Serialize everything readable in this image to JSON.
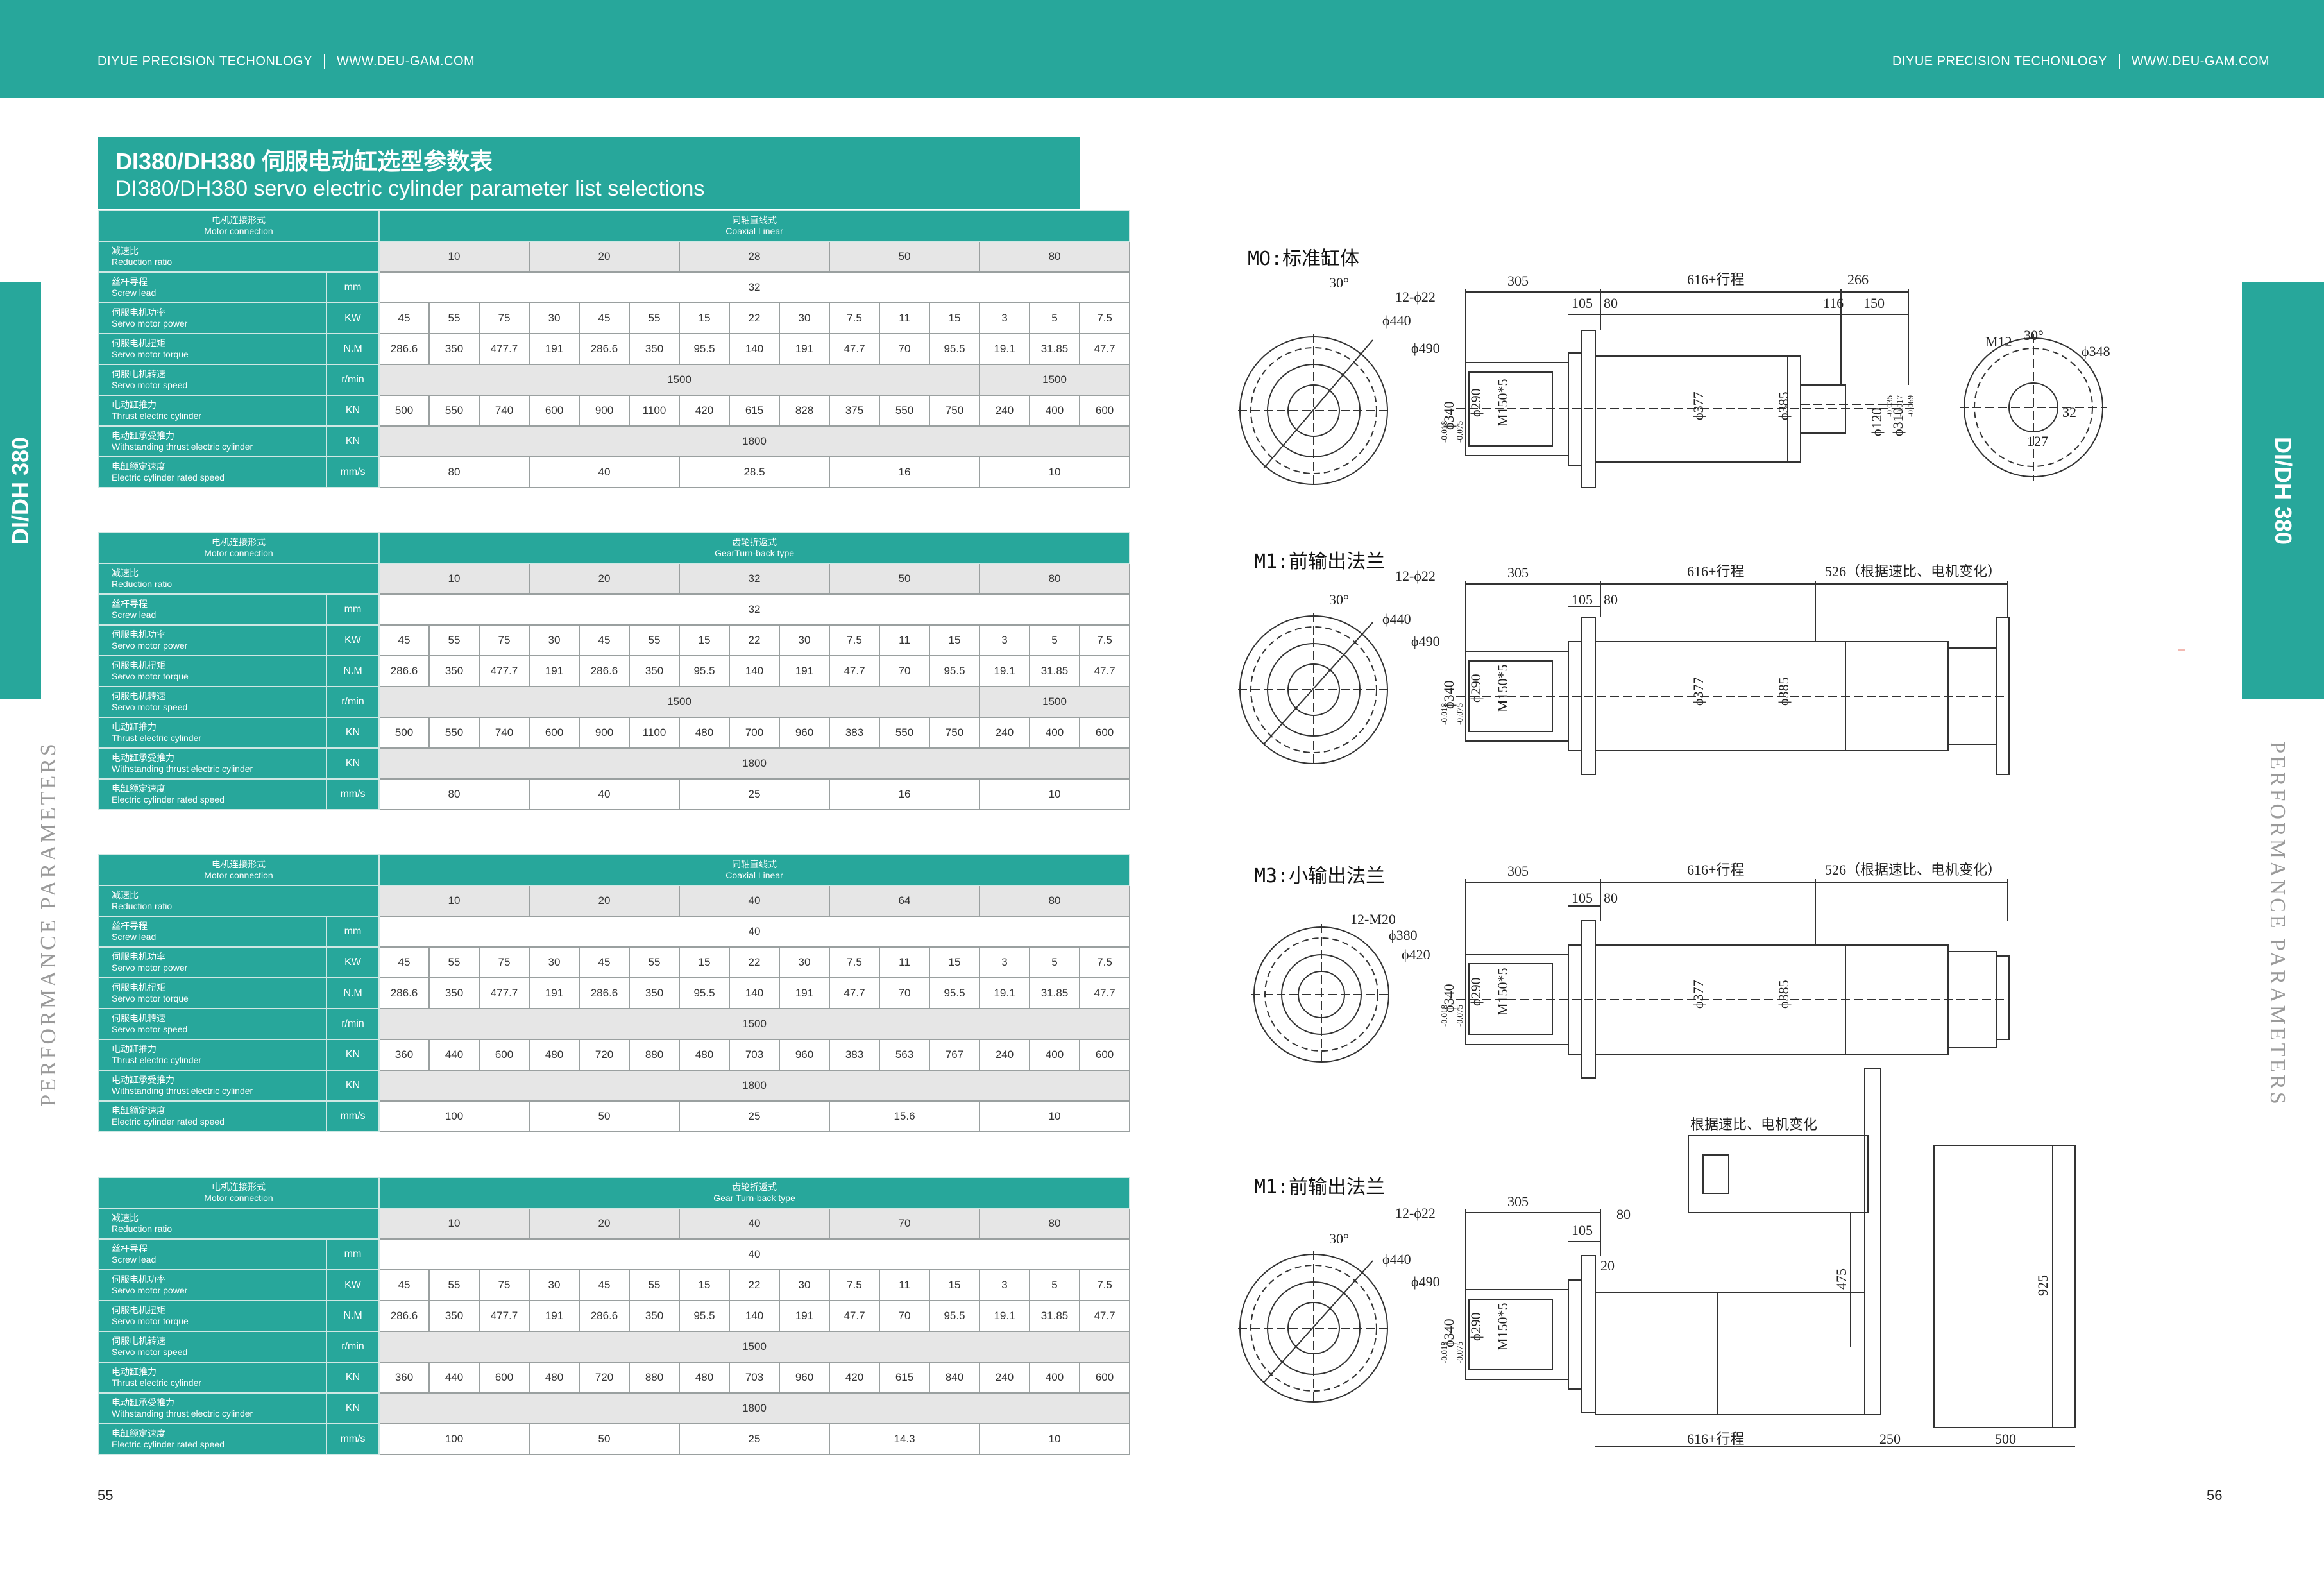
{
  "header": {
    "left": {
      "company": "DIYUE PRECISION TECHONLOGY",
      "url": "WWW.DEU-GAM.COM"
    },
    "right": {
      "company": "DIYUE PRECISION TECHONLOGY",
      "url": "WWW.DEU-GAM.COM"
    }
  },
  "side": {
    "left_tab": "DI/DH 380",
    "right_tab": "DI/DH 380",
    "left_vertical": "PERFORMANCE PARAMETERS",
    "right_vertical": "PERFORMANCE PARAMETERS"
  },
  "title": {
    "cn": "DI380/DH380 伺服电动缸选型参数表",
    "en": "DI380/DH380 servo electric cylinder parameter list selections"
  },
  "row_labels": {
    "conn": {
      "cn": "电机连接形式",
      "en": "Motor connection"
    },
    "ratio": {
      "cn": "减速比",
      "en": "Reduction ratio"
    },
    "lead": {
      "cn": "丝杆导程",
      "en": "Screw lead"
    },
    "power": {
      "cn": "伺服电机功率",
      "en": "Servo motor power"
    },
    "torque": {
      "cn": "伺服电机扭矩",
      "en": "Servo motor torque"
    },
    "speed": {
      "cn": "伺服电机转速",
      "en": "Servo motor speed"
    },
    "thrust": {
      "cn": "电动缸推力",
      "en": "Thrust electric cylinder"
    },
    "withstand": {
      "cn": "电动缸承受推力",
      "en": "Withstanding thrust electric cylinder"
    },
    "rated": {
      "cn": "电缸额定速度",
      "en": "Electric cylinder rated speed"
    }
  },
  "units": {
    "lead": "mm",
    "power": "KW",
    "torque": "N.M",
    "speed": "r/min",
    "thrust": "KN",
    "withstand": "KN",
    "rated": "mm/s"
  },
  "tables": [
    {
      "conn_cn": "同轴直线式",
      "conn_en": "Coaxial Linear",
      "ratios": [
        "10",
        "20",
        "28",
        "50",
        "80"
      ],
      "lead": "32",
      "power": [
        "45",
        "55",
        "75",
        "30",
        "45",
        "55",
        "15",
        "22",
        "30",
        "7.5",
        "11",
        "15",
        "3",
        "5",
        "7.5"
      ],
      "torque": [
        "286.6",
        "350",
        "477.7",
        "191",
        "286.6",
        "350",
        "95.5",
        "140",
        "191",
        "47.7",
        "70",
        "95.5",
        "19.1",
        "31.85",
        "47.7"
      ],
      "speed": [
        "1500",
        "1500"
      ],
      "thrust": [
        "500",
        "550",
        "740",
        "600",
        "900",
        "1100",
        "420",
        "615",
        "828",
        "375",
        "550",
        "750",
        "240",
        "400",
        "600"
      ],
      "withstand": "1800",
      "rated": [
        "80",
        "40",
        "28.5",
        "16",
        "10"
      ]
    },
    {
      "conn_cn": "齿轮折返式",
      "conn_en": "GearTurn-back type",
      "ratios": [
        "10",
        "20",
        "32",
        "50",
        "80"
      ],
      "lead": "32",
      "power": [
        "45",
        "55",
        "75",
        "30",
        "45",
        "55",
        "15",
        "22",
        "30",
        "7.5",
        "11",
        "15",
        "3",
        "5",
        "7.5"
      ],
      "torque": [
        "286.6",
        "350",
        "477.7",
        "191",
        "286.6",
        "350",
        "95.5",
        "140",
        "191",
        "47.7",
        "70",
        "95.5",
        "19.1",
        "31.85",
        "47.7"
      ],
      "speed": [
        "1500",
        "1500"
      ],
      "thrust": [
        "500",
        "550",
        "740",
        "600",
        "900",
        "1100",
        "480",
        "700",
        "960",
        "383",
        "550",
        "750",
        "240",
        "400",
        "600"
      ],
      "withstand": "1800",
      "rated": [
        "80",
        "40",
        "25",
        "16",
        "10"
      ]
    },
    {
      "conn_cn": "同轴直线式",
      "conn_en": "Coaxial Linear",
      "ratios": [
        "10",
        "20",
        "40",
        "64",
        "80"
      ],
      "lead": "40",
      "power": [
        "45",
        "55",
        "75",
        "30",
        "45",
        "55",
        "15",
        "22",
        "30",
        "7.5",
        "11",
        "15",
        "3",
        "5",
        "7.5"
      ],
      "torque": [
        "286.6",
        "350",
        "477.7",
        "191",
        "286.6",
        "350",
        "95.5",
        "140",
        "191",
        "47.7",
        "70",
        "95.5",
        "19.1",
        "31.85",
        "47.7"
      ],
      "speed": [
        "1500"
      ],
      "thrust": [
        "360",
        "440",
        "600",
        "480",
        "720",
        "880",
        "480",
        "703",
        "960",
        "383",
        "563",
        "767",
        "240",
        "400",
        "600"
      ],
      "withstand": "1800",
      "rated": [
        "100",
        "50",
        "25",
        "15.6",
        "10"
      ]
    },
    {
      "conn_cn": "齿轮折返式",
      "conn_en": "Gear Turn-back type",
      "ratios": [
        "10",
        "20",
        "40",
        "70",
        "80"
      ],
      "lead": "40",
      "power": [
        "45",
        "55",
        "75",
        "30",
        "45",
        "55",
        "15",
        "22",
        "30",
        "7.5",
        "11",
        "15",
        "3",
        "5",
        "7.5"
      ],
      "torque": [
        "286.6",
        "350",
        "477.7",
        "191",
        "286.6",
        "350",
        "95.5",
        "140",
        "191",
        "47.7",
        "70",
        "95.5",
        "19.1",
        "31.85",
        "47.7"
      ],
      "speed": [
        "1500"
      ],
      "thrust": [
        "360",
        "440",
        "600",
        "480",
        "720",
        "880",
        "480",
        "703",
        "960",
        "420",
        "615",
        "840",
        "240",
        "400",
        "600"
      ],
      "withstand": "1800",
      "rated": [
        "100",
        "50",
        "25",
        "14.3",
        "10"
      ]
    }
  ],
  "drawings": {
    "d1": {
      "title": "MO:标准缸体",
      "dims": {
        "a": "305",
        "b": "616+行程",
        "c": "266",
        "d": "105",
        "e": "80",
        "f": "116",
        "g": "150",
        "bolt": "12-ϕ22",
        "ang": "30°",
        "p440": "ϕ440",
        "p490": "ϕ490",
        "m12": "M12",
        "ang2": "30°",
        "p348": "ϕ348",
        "d127": "127",
        "d32": "32",
        "p340": "ϕ340",
        "p290": "ϕ290",
        "m150": "M150*5",
        "p377": "ϕ377",
        "p385": "ϕ385",
        "p120": "ϕ120",
        "p310": "ϕ310"
      }
    },
    "d2": {
      "title": "M1:前输出法兰",
      "dims": {
        "a": "305",
        "b": "616+行程",
        "c": "526（根据速比、电机变化）",
        "d": "105",
        "e": "80",
        "bolt": "12-ϕ22",
        "ang": "30°",
        "p440": "ϕ440",
        "p490": "ϕ490",
        "p340": "ϕ340",
        "p290": "ϕ290",
        "m150": "M150*5",
        "p377": "ϕ377",
        "p385": "ϕ385"
      }
    },
    "d3": {
      "title": "M3:小输出法兰",
      "dims": {
        "a": "305",
        "b": "616+行程",
        "c": "526（根据速比、电机变化）",
        "d": "105",
        "e": "80",
        "bolt": "12-M20",
        "ang": "30°",
        "p380": "ϕ380",
        "p420": "ϕ420",
        "p340": "ϕ340",
        "p290": "ϕ290",
        "m150": "M150*5",
        "p377": "ϕ377",
        "p385": "ϕ385"
      }
    },
    "d4": {
      "title": "M1:前输出法兰",
      "dims": {
        "note": "根据速比、电机变化",
        "a": "305",
        "d": "105",
        "e": "80",
        "f": "20",
        "h475": "475",
        "h925": "925",
        "b": "616+行程",
        "g": "250",
        "w": "500",
        "bolt": "12-ϕ22",
        "ang": "30°",
        "p440": "ϕ440",
        "p490": "ϕ490",
        "p340": "ϕ340",
        "p290": "ϕ290",
        "m150": "M150*5"
      }
    }
  },
  "tolerances": {
    "p340_up": "-0.018",
    "p340_lo": "-0.075",
    "p120_up": "0",
    "p120_lo": "-0.035",
    "p310_up": "-0.017",
    "p310_lo": "-0.069"
  },
  "pages": {
    "left": "55",
    "right": "56"
  }
}
